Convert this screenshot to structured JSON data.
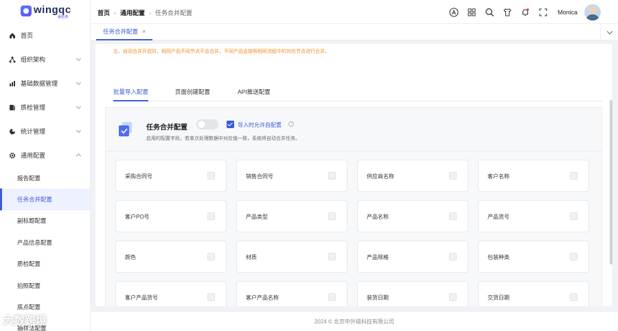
{
  "brand": {
    "name": "wingqc",
    "tagline": "赢检通"
  },
  "sidebar": {
    "items": [
      {
        "label": "首页",
        "icon": "home-icon",
        "expandable": false
      },
      {
        "label": "组织架构",
        "icon": "org-icon",
        "expandable": true
      },
      {
        "label": "基础数据管理",
        "icon": "data-icon",
        "expandable": true
      },
      {
        "label": "质检管理",
        "icon": "inspect-icon",
        "expandable": true
      },
      {
        "label": "统计管理",
        "icon": "pie-icon",
        "expandable": true
      },
      {
        "label": "通用配置",
        "icon": "gear-icon",
        "expandable": true,
        "expanded": true
      }
    ],
    "subitems": [
      {
        "label": "报告配置",
        "active": false
      },
      {
        "label": "任务合并配置",
        "active": true
      },
      {
        "label": "副标题配置",
        "active": false
      },
      {
        "label": "产品信息配置",
        "active": false
      },
      {
        "label": "质检配置",
        "active": false
      },
      {
        "label": "拍照配置",
        "active": false
      },
      {
        "label": "底点配置",
        "active": false
      },
      {
        "label": "抽样法配置",
        "active": false
      }
    ]
  },
  "header": {
    "breadcrumb": [
      "首页",
      "通用配置",
      "任务合并配置"
    ],
    "user": "Monica",
    "icons": [
      "translate-icon",
      "apps-icon",
      "search-icon",
      "shirt-icon",
      "bell-icon",
      "fullscreen-icon"
    ]
  },
  "tabs": [
    {
      "label": "任务合并配置",
      "closable": true
    }
  ],
  "notice": "五、自动合并开启时，相同产品不同节点不会合并，不同产品会按照相同流程中的对应节点进行合并。",
  "subtabs": [
    "批量导入配置",
    "页面创建配置",
    "API推送配置"
  ],
  "config": {
    "title": "任务合并配置",
    "switch_on": false,
    "checkbox_label": "导入时允许自配置",
    "checkbox_checked": true,
    "description": "启用的配置字段，若单次处理数据中对应值一致，系统将自动合并任务。"
  },
  "fields": [
    "采购合同号",
    "销售合同号",
    "供应商名称",
    "客户名称",
    "客户PO号",
    "产品类型",
    "产品名称",
    "产品货号",
    "颜色",
    "材质",
    "产品规格",
    "包装种类",
    "客户产品货号",
    "客户产品名称",
    "装货日期",
    "交货日期"
  ],
  "footer": "2024 © 北京中外链科技有限公司",
  "watermark": "大数跨境",
  "colors": {
    "primary": "#3b5bdb",
    "warning": "#f5881f"
  }
}
